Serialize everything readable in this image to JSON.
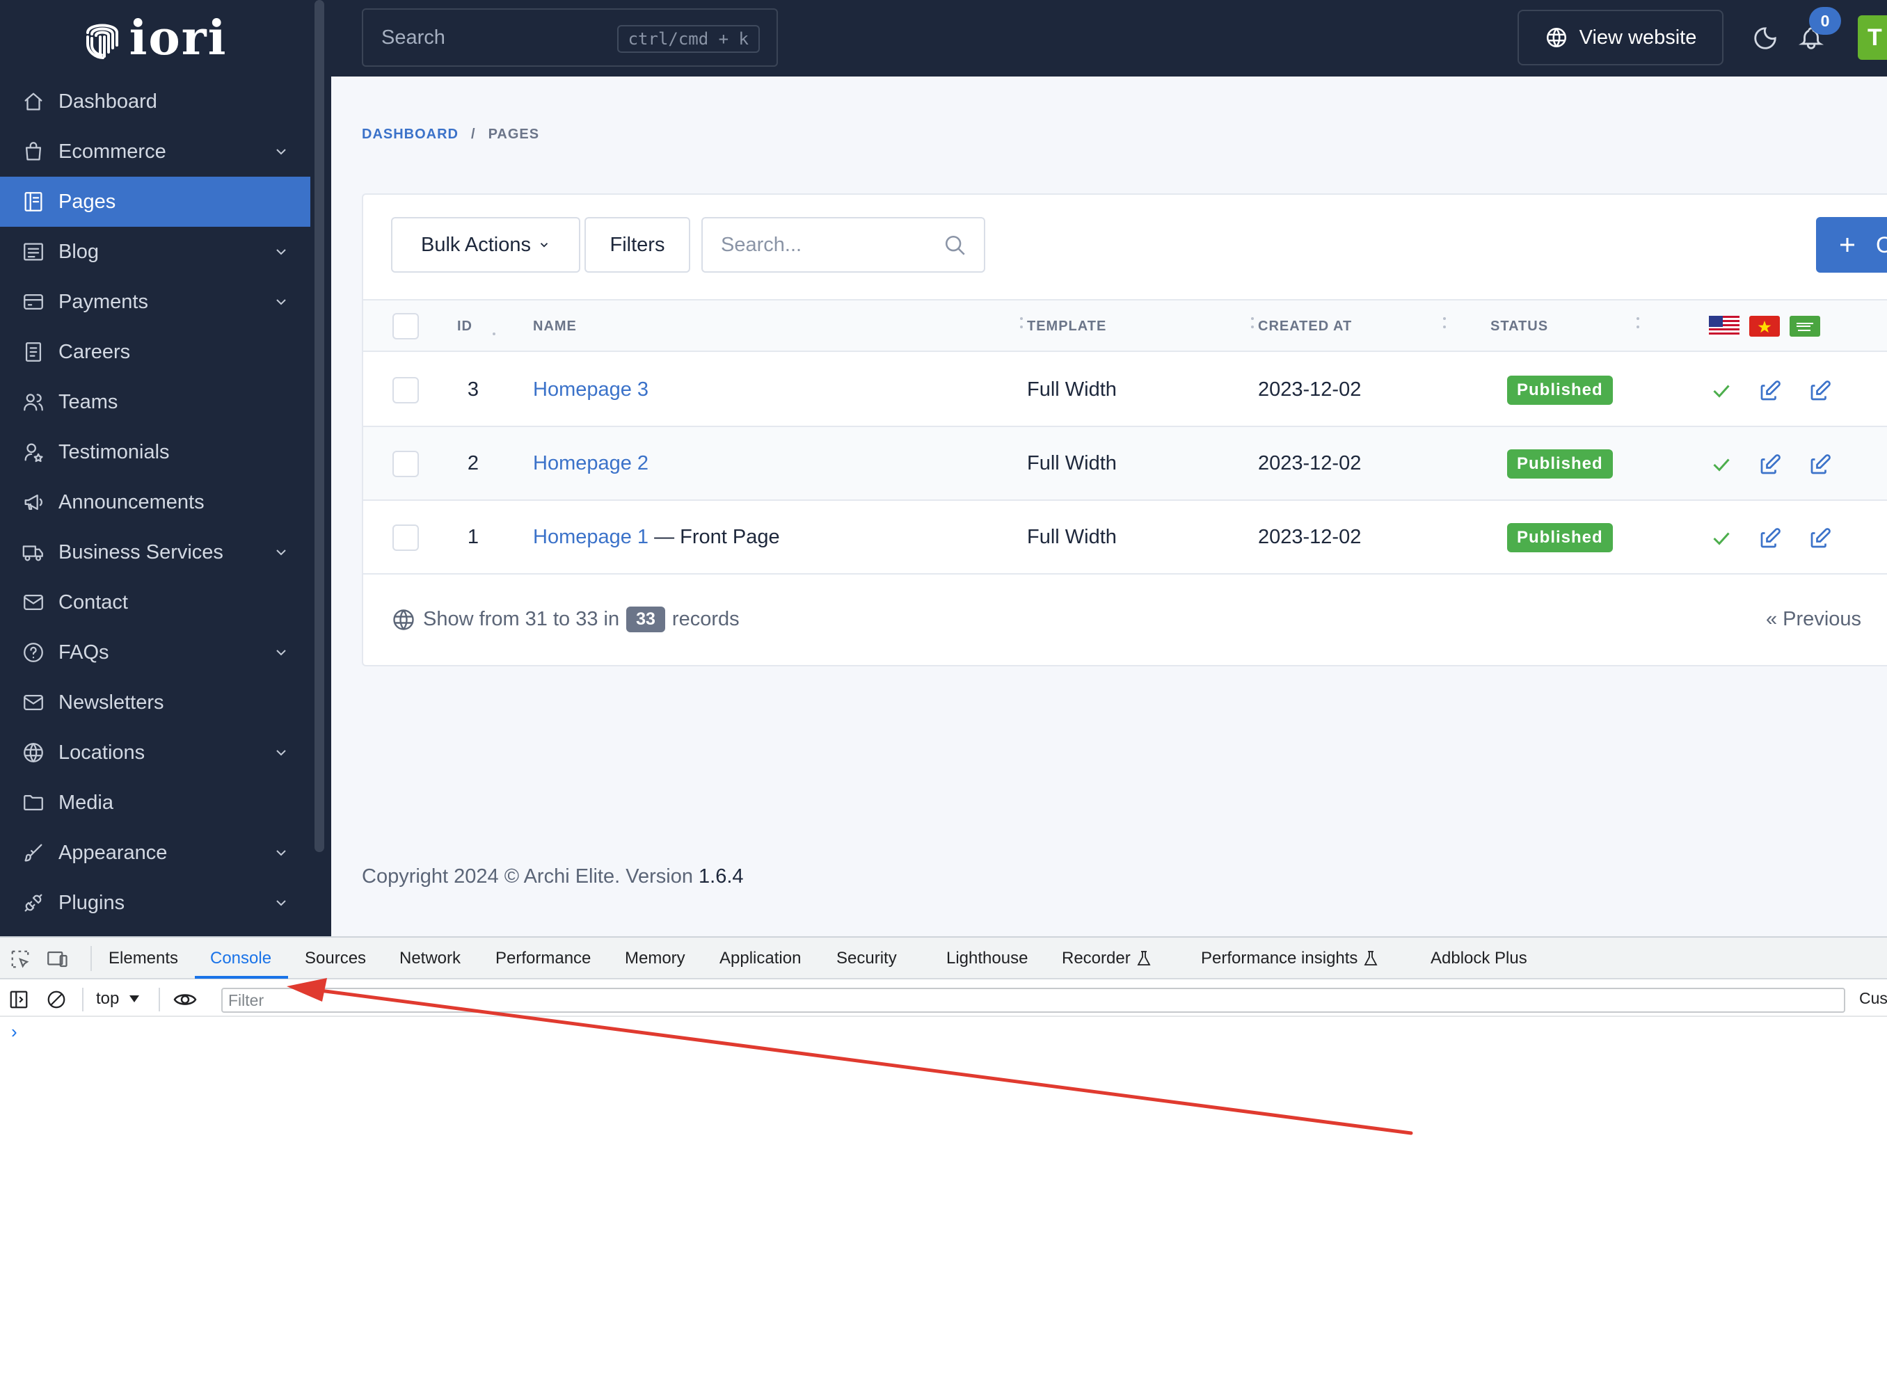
{
  "brand": {
    "logo_text": "iori"
  },
  "sidebar": {
    "items": [
      {
        "label": "Dashboard",
        "icon": "home-icon",
        "has_children": false,
        "active": false
      },
      {
        "label": "Ecommerce",
        "icon": "shopping-bag-icon",
        "has_children": true,
        "active": false
      },
      {
        "label": "Pages",
        "icon": "book-icon",
        "has_children": false,
        "active": true
      },
      {
        "label": "Blog",
        "icon": "article-icon",
        "has_children": true,
        "active": false
      },
      {
        "label": "Payments",
        "icon": "credit-card-icon",
        "has_children": true,
        "active": false
      },
      {
        "label": "Careers",
        "icon": "file-text-icon",
        "has_children": false,
        "active": false
      },
      {
        "label": "Teams",
        "icon": "users-icon",
        "has_children": false,
        "active": false
      },
      {
        "label": "Testimonials",
        "icon": "user-star-icon",
        "has_children": false,
        "active": false
      },
      {
        "label": "Announcements",
        "icon": "speakerphone-icon",
        "has_children": false,
        "active": false
      },
      {
        "label": "Business Services",
        "icon": "truck-icon",
        "has_children": true,
        "active": false
      },
      {
        "label": "Contact",
        "icon": "mail-icon",
        "has_children": false,
        "active": false
      },
      {
        "label": "FAQs",
        "icon": "help-circle-icon",
        "has_children": true,
        "active": false
      },
      {
        "label": "Newsletters",
        "icon": "mail-icon",
        "has_children": false,
        "active": false
      },
      {
        "label": "Locations",
        "icon": "globe-icon",
        "has_children": true,
        "active": false
      },
      {
        "label": "Media",
        "icon": "folder-icon",
        "has_children": false,
        "active": false
      },
      {
        "label": "Appearance",
        "icon": "brush-icon",
        "has_children": true,
        "active": false
      },
      {
        "label": "Plugins",
        "icon": "plug-icon",
        "has_children": true,
        "active": false
      }
    ]
  },
  "topbar": {
    "search_placeholder": "Search",
    "search_shortcut": "ctrl/cmd + k",
    "view_website": "View website",
    "notifications_count": "0",
    "avatar_initial": "T"
  },
  "breadcrumb": {
    "home": "DASHBOARD",
    "separator": "/",
    "current": "PAGES"
  },
  "toolbar": {
    "bulk_actions": "Bulk Actions",
    "filters": "Filters",
    "search_placeholder": "Search...",
    "create_label": "C"
  },
  "table": {
    "columns": {
      "id": "ID",
      "name": "NAME",
      "template": "TEMPLATE",
      "created_at": "CREATED AT",
      "status": "STATUS"
    },
    "language_flags": [
      "us-flag-icon",
      "vietnam-flag-icon",
      "saudi-flag-icon"
    ],
    "rows": [
      {
        "id": "3",
        "name": "Homepage 3",
        "suffix": "",
        "template": "Full Width",
        "created_at": "2023-12-02",
        "status": "Published"
      },
      {
        "id": "2",
        "name": "Homepage 2",
        "suffix": "",
        "template": "Full Width",
        "created_at": "2023-12-02",
        "status": "Published"
      },
      {
        "id": "1",
        "name": "Homepage 1",
        "suffix": " — Front Page",
        "template": "Full Width",
        "created_at": "2023-12-02",
        "status": "Published"
      }
    ]
  },
  "pagination": {
    "prefix": "Show from 31 to 33 in",
    "total": "33",
    "suffix": "records",
    "previous": "« Previous"
  },
  "footer": {
    "copyright": "Copyright 2024 © Archi Elite. Version",
    "version": "1.6.4"
  },
  "devtools": {
    "tabs": [
      "Elements",
      "Console",
      "Sources",
      "Network",
      "Performance",
      "Memory",
      "Application",
      "Security",
      "Lighthouse",
      "Recorder",
      "Performance insights",
      "Adblock Plus"
    ],
    "active_tab": "Console",
    "context": "top",
    "filter_placeholder": "Filter",
    "custom_levels": "Cus",
    "prompt": "›"
  },
  "colors": {
    "sidebar_bg": "#1d273b",
    "accent": "#3b72c9",
    "success": "#4cae4c",
    "annotation_arrow": "#e03a2f"
  }
}
